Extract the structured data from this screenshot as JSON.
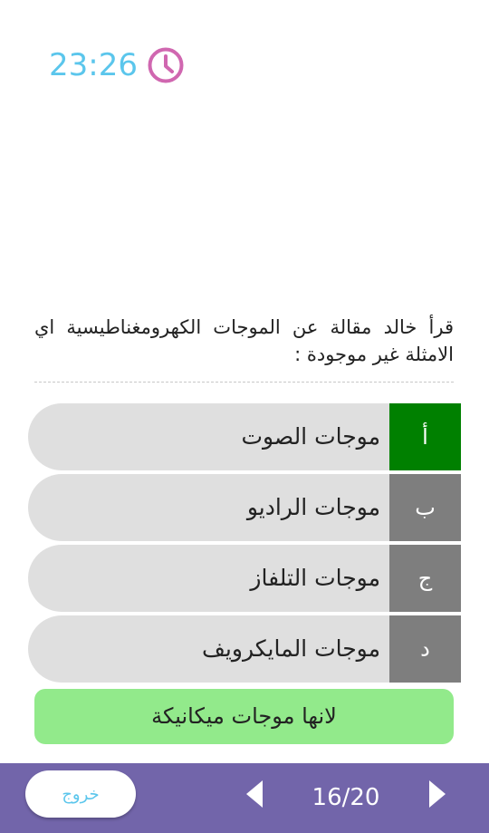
{
  "timer": {
    "time": "23:26",
    "icon": "clock-icon",
    "time_color": "#5bc6ec",
    "icon_color": "#d067b0"
  },
  "question": {
    "text": "قرأ خالد مقالة عن الموجات الكهرومغناطيسية اي الامثلة غير موجودة :"
  },
  "options": [
    {
      "letter": "أ",
      "text": "موجات الصوت",
      "state": "correct"
    },
    {
      "letter": "ب",
      "text": "موجات الراديو",
      "state": "normal"
    },
    {
      "letter": "ج",
      "text": "موجات التلفاز",
      "state": "normal"
    },
    {
      "letter": "د",
      "text": "موجات المايكرويف",
      "state": "normal"
    }
  ],
  "explanation": {
    "text": "لانها موجات ميكانيكة"
  },
  "bottom_bar": {
    "exit_label": "خروج",
    "counter": "16/20",
    "prev_icon": "triangle-left-icon",
    "next_icon": "triangle-right-icon"
  },
  "colors": {
    "correct": "#008000",
    "option_letter_bg": "#7e7e7e",
    "option_bg": "#dfdfdf",
    "explanation_bg": "#92ea8b",
    "bottom_bar": "#7265aa"
  }
}
